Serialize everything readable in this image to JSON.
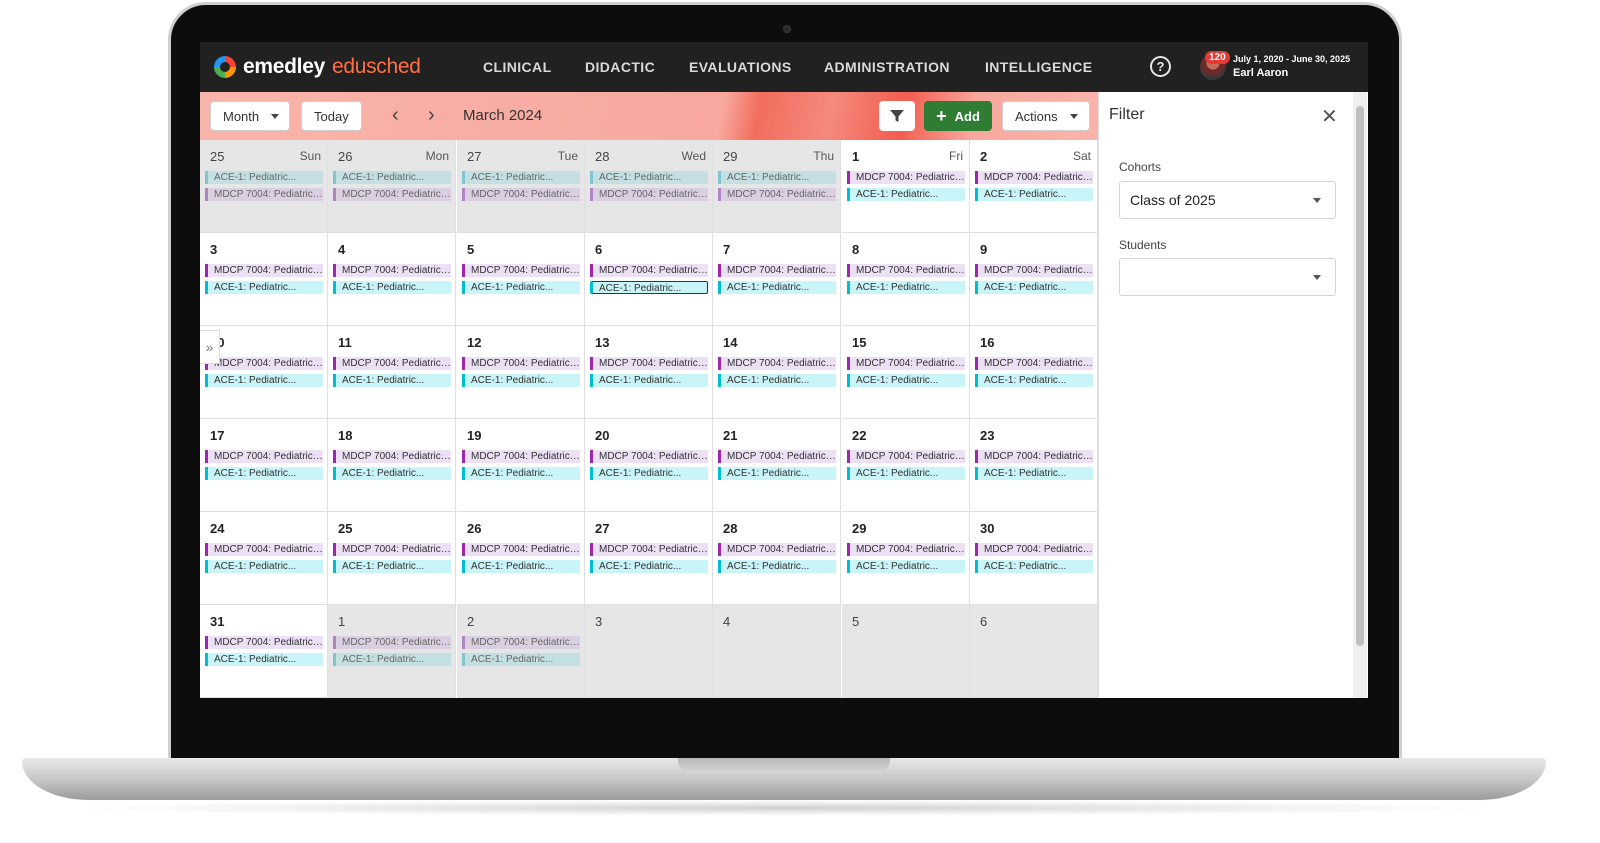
{
  "app": {
    "logo_primary": "emedley",
    "logo_secondary": "edusched",
    "nav": [
      "CLINICAL",
      "DIDACTIC",
      "EVALUATIONS",
      "ADMINISTRATION",
      "INTELLIGENCE"
    ],
    "help_glyph": "?",
    "notification_count": "120",
    "date_range": "July 1, 2020 - June 30, 2025",
    "user_name": "Earl Aaron"
  },
  "toolbar": {
    "view_label": "Month",
    "today_label": "Today",
    "prev_glyph": "‹",
    "next_glyph": "›",
    "title": "March 2024",
    "add_glyph": "+",
    "add_label": "Add",
    "actions_label": "Actions"
  },
  "calendar": {
    "weeks": [
      [
        {
          "day": "25",
          "dow": "Sun",
          "muted": true,
          "events": [
            "ACE-1: Pediatric...",
            "MDCP 7004: Pediatrics..."
          ]
        },
        {
          "day": "26",
          "dow": "Mon",
          "muted": true,
          "events": [
            "ACE-1: Pediatric...",
            "MDCP 7004: Pediatrics..."
          ]
        },
        {
          "day": "27",
          "dow": "Tue",
          "muted": true,
          "events": [
            "ACE-1: Pediatric...",
            "MDCP 7004: Pediatrics..."
          ]
        },
        {
          "day": "28",
          "dow": "Wed",
          "muted": true,
          "events": [
            "ACE-1: Pediatric...",
            "MDCP 7004: Pediatrics..."
          ]
        },
        {
          "day": "29",
          "dow": "Thu",
          "muted": true,
          "events": [
            "ACE-1: Pediatric...",
            "MDCP 7004: Pediatrics..."
          ]
        },
        {
          "day": "1",
          "dow": "Fri",
          "muted": false,
          "events": [
            "MDCP 7004: Pediatrics...",
            "ACE-1: Pediatric..."
          ]
        },
        {
          "day": "2",
          "dow": "Sat",
          "muted": false,
          "events": [
            "MDCP 7004: Pediatrics...",
            "ACE-1: Pediatric..."
          ]
        }
      ],
      [
        {
          "day": "3",
          "muted": false,
          "events": [
            "MDCP 7004: Pediatrics...",
            "ACE-1: Pediatric..."
          ]
        },
        {
          "day": "4",
          "muted": false,
          "events": [
            "MDCP 7004: Pediatrics...",
            "ACE-1: Pediatric..."
          ]
        },
        {
          "day": "5",
          "muted": false,
          "events": [
            "MDCP 7004: Pediatrics...",
            "ACE-1: Pediatric..."
          ]
        },
        {
          "day": "6",
          "muted": false,
          "events": [
            "MDCP 7004: Pediatrics...",
            "ACE-1: Pediatric..."
          ],
          "selected_event": 1
        },
        {
          "day": "7",
          "muted": false,
          "events": [
            "MDCP 7004: Pediatrics...",
            "ACE-1: Pediatric..."
          ]
        },
        {
          "day": "8",
          "muted": false,
          "events": [
            "MDCP 7004: Pediatrics...",
            "ACE-1: Pediatric..."
          ]
        },
        {
          "day": "9",
          "muted": false,
          "events": [
            "MDCP 7004: Pediatrics...",
            "ACE-1: Pediatric..."
          ]
        }
      ],
      [
        {
          "day": "10",
          "muted": false,
          "events": [
            "MDCP 7004: Pediatrics...",
            "ACE-1: Pediatric..."
          ]
        },
        {
          "day": "11",
          "muted": false,
          "events": [
            "MDCP 7004: Pediatrics...",
            "ACE-1: Pediatric..."
          ]
        },
        {
          "day": "12",
          "muted": false,
          "events": [
            "MDCP 7004: Pediatrics...",
            "ACE-1: Pediatric..."
          ]
        },
        {
          "day": "13",
          "muted": false,
          "events": [
            "MDCP 7004: Pediatrics...",
            "ACE-1: Pediatric..."
          ]
        },
        {
          "day": "14",
          "muted": false,
          "events": [
            "MDCP 7004: Pediatrics...",
            "ACE-1: Pediatric..."
          ]
        },
        {
          "day": "15",
          "muted": false,
          "events": [
            "MDCP 7004: Pediatrics...",
            "ACE-1: Pediatric..."
          ]
        },
        {
          "day": "16",
          "muted": false,
          "events": [
            "MDCP 7004: Pediatrics...",
            "ACE-1: Pediatric..."
          ]
        }
      ],
      [
        {
          "day": "17",
          "muted": false,
          "events": [
            "MDCP 7004: Pediatrics...",
            "ACE-1: Pediatric..."
          ]
        },
        {
          "day": "18",
          "muted": false,
          "events": [
            "MDCP 7004: Pediatrics...",
            "ACE-1: Pediatric..."
          ]
        },
        {
          "day": "19",
          "muted": false,
          "events": [
            "MDCP 7004: Pediatrics...",
            "ACE-1: Pediatric..."
          ]
        },
        {
          "day": "20",
          "muted": false,
          "events": [
            "MDCP 7004: Pediatrics...",
            "ACE-1: Pediatric..."
          ]
        },
        {
          "day": "21",
          "muted": false,
          "events": [
            "MDCP 7004: Pediatrics...",
            "ACE-1: Pediatric..."
          ]
        },
        {
          "day": "22",
          "muted": false,
          "events": [
            "MDCP 7004: Pediatrics...",
            "ACE-1: Pediatric..."
          ]
        },
        {
          "day": "23",
          "muted": false,
          "events": [
            "MDCP 7004: Pediatrics...",
            "ACE-1: Pediatric..."
          ]
        }
      ],
      [
        {
          "day": "24",
          "muted": false,
          "events": [
            "MDCP 7004: Pediatrics...",
            "ACE-1: Pediatric..."
          ]
        },
        {
          "day": "25",
          "muted": false,
          "events": [
            "MDCP 7004: Pediatrics...",
            "ACE-1: Pediatric..."
          ]
        },
        {
          "day": "26",
          "muted": false,
          "events": [
            "MDCP 7004: Pediatrics...",
            "ACE-1: Pediatric..."
          ]
        },
        {
          "day": "27",
          "muted": false,
          "events": [
            "MDCP 7004: Pediatrics...",
            "ACE-1: Pediatric..."
          ]
        },
        {
          "day": "28",
          "muted": false,
          "events": [
            "MDCP 7004: Pediatrics...",
            "ACE-1: Pediatric..."
          ]
        },
        {
          "day": "29",
          "muted": false,
          "events": [
            "MDCP 7004: Pediatrics...",
            "ACE-1: Pediatric..."
          ]
        },
        {
          "day": "30",
          "muted": false,
          "events": [
            "MDCP 7004: Pediatrics...",
            "ACE-1: Pediatric..."
          ]
        }
      ],
      [
        {
          "day": "31",
          "muted": false,
          "events": [
            "MDCP 7004: Pediatrics...",
            "ACE-1: Pediatric..."
          ]
        },
        {
          "day": "1",
          "muted": true,
          "events": [
            "MDCP 7004: Pediatrics...",
            "ACE-1: Pediatric..."
          ]
        },
        {
          "day": "2",
          "muted": true,
          "events": [
            "MDCP 7004: Pediatrics...",
            "ACE-1: Pediatric..."
          ]
        },
        {
          "day": "3",
          "muted": true,
          "events": []
        },
        {
          "day": "4",
          "muted": true,
          "events": []
        },
        {
          "day": "5",
          "muted": true,
          "events": []
        },
        {
          "day": "6",
          "muted": true,
          "events": []
        }
      ]
    ],
    "expand_glyph": "»"
  },
  "filter": {
    "title": "Filter",
    "close_glyph": "✕",
    "cohorts_label": "Cohorts",
    "cohorts_value": "Class of 2025",
    "students_label": "Students",
    "students_value": ""
  },
  "colors": {
    "nav_bg": "#212121",
    "toolbar_bg": "#f8a89e",
    "add_green": "#2e7d32",
    "mdcp_purple": "#9c27b0",
    "ace_cyan": "#00bcd4",
    "badge_red": "#e53935"
  },
  "icons": {
    "help": "help-circle-icon",
    "filter": "filter-funnel-icon",
    "add": "plus-icon",
    "prev": "chevron-left-icon",
    "next": "chevron-right-icon",
    "close": "close-icon",
    "expand": "double-chevron-right-icon"
  }
}
